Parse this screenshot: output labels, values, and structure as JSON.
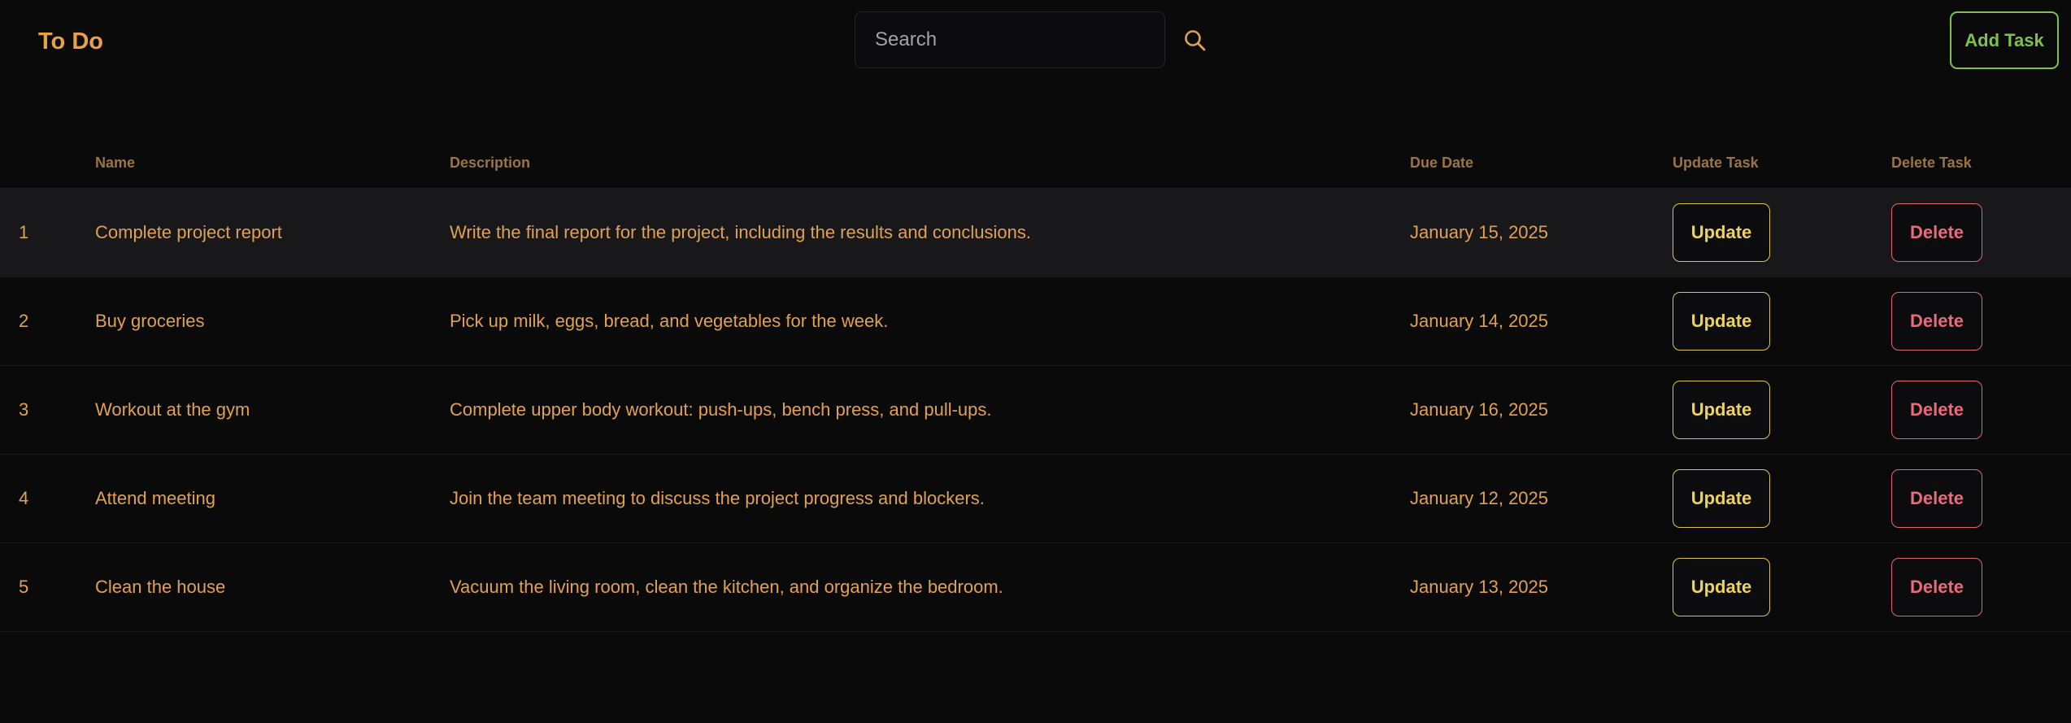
{
  "header": {
    "title": "To Do",
    "search_placeholder": "Search",
    "search_value": "",
    "search_icon": "search-icon",
    "add_task_label": "Add Task"
  },
  "table": {
    "columns": {
      "num": "",
      "name": "Name",
      "description": "Description",
      "due_date": "Due Date",
      "update": "Update Task",
      "delete": "Delete Task"
    },
    "rows": [
      {
        "num": "1",
        "name": "Complete project report",
        "description": "Write the final report for the project, including the results and conclusions.",
        "due_date": "January 15, 2025",
        "update_label": "Update",
        "delete_label": "Delete"
      },
      {
        "num": "2",
        "name": "Buy groceries",
        "description": "Pick up milk, eggs, bread, and vegetables for the week.",
        "due_date": "January 14, 2025",
        "update_label": "Update",
        "delete_label": "Delete"
      },
      {
        "num": "3",
        "name": "Workout at the gym",
        "description": "Complete upper body workout: push-ups, bench press, and pull-ups.",
        "due_date": "January 16, 2025",
        "update_label": "Update",
        "delete_label": "Delete"
      },
      {
        "num": "4",
        "name": "Attend meeting",
        "description": "Join the team meeting to discuss the project progress and blockers.",
        "due_date": "January 12, 2025",
        "update_label": "Update",
        "delete_label": "Delete"
      },
      {
        "num": "5",
        "name": "Clean the house",
        "description": "Vacuum the living room, clean the kitchen, and organize the bedroom.",
        "due_date": "January 13, 2025",
        "update_label": "Update",
        "delete_label": "Delete"
      }
    ]
  },
  "colors": {
    "background": "#0a0a0b",
    "accent_orange": "#e0a153",
    "header_text": "#9a7346",
    "add_green": "#7ec14b",
    "update_yellow": "#ecd35e",
    "delete_red": "#ea6a79",
    "highlight_row": "#18181b"
  }
}
